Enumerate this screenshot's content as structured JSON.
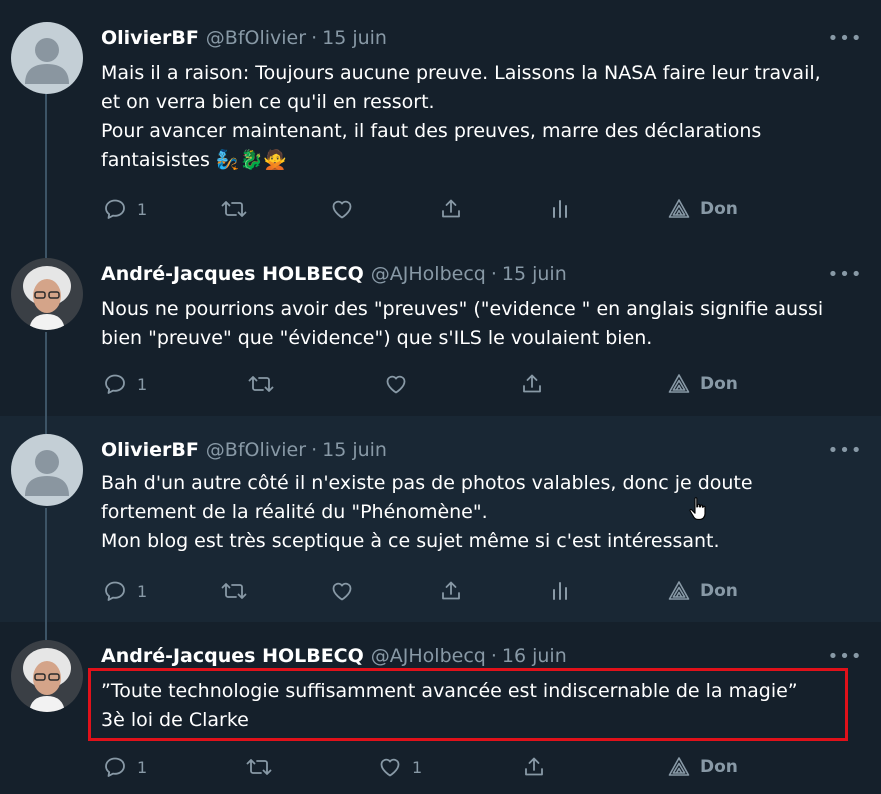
{
  "colors": {
    "background": "#15202b",
    "highlight_background": "#192734",
    "text": "#ffffff",
    "secondary_text": "#8899a6",
    "annotation_box": "#e0111a"
  },
  "tweets": [
    {
      "name": "OlivierBF",
      "handle": "@BfOlivier",
      "separator": "·",
      "date": "15 juin",
      "lines": [
        "Mais il a raison: Toujours aucune preuve. Laissons la NASA faire leur travail,",
        "et on verra bien ce qu'il en ressort.",
        "Pour avancer maintenant, il faut des preuves, marre des déclarations",
        "fantaisistes 🧞🐉🙅"
      ],
      "reply_count": "1",
      "like_count": "",
      "don_label": "Don",
      "more_label": "•••",
      "avatar": "default-avatar"
    },
    {
      "name": "André-Jacques HOLBECQ",
      "handle": "@AJHolbecq",
      "separator": "·",
      "date": "15 juin",
      "lines": [
        "Nous ne pourrions avoir des \"preuves\" (\"evidence \" en anglais signifie aussi",
        "bien \"preuve\" que \"évidence\") que s'ILS le voulaient bien."
      ],
      "reply_count": "1",
      "like_count": "",
      "don_label": "Don",
      "more_label": "•••",
      "avatar": "photo-avatar"
    },
    {
      "name": "OlivierBF",
      "handle": "@BfOlivier",
      "separator": "·",
      "date": "15 juin",
      "lines": [
        "Bah d'un autre côté il n'existe pas de photos valables, donc je doute",
        "fortement de la réalité du \"Phénomène\".",
        "Mon blog est très sceptique à ce sujet même si c'est intéressant."
      ],
      "reply_count": "1",
      "like_count": "",
      "don_label": "Don",
      "more_label": "•••",
      "avatar": "default-avatar"
    },
    {
      "name": "André-Jacques HOLBECQ",
      "handle": "@AJHolbecq",
      "separator": "·",
      "date": "16 juin",
      "lines": [
        "”Toute technologie suffisamment avancée est indiscernable de la magie”",
        "3è loi de Clarke"
      ],
      "reply_count": "1",
      "like_count": "1",
      "don_label": "Don",
      "more_label": "•••",
      "avatar": "photo-avatar"
    }
  ],
  "icons": [
    "reply-icon",
    "retweet-icon",
    "like-icon",
    "share-icon",
    "analytics-icon",
    "don-icon",
    "more-icon",
    "hand-cursor-icon"
  ]
}
